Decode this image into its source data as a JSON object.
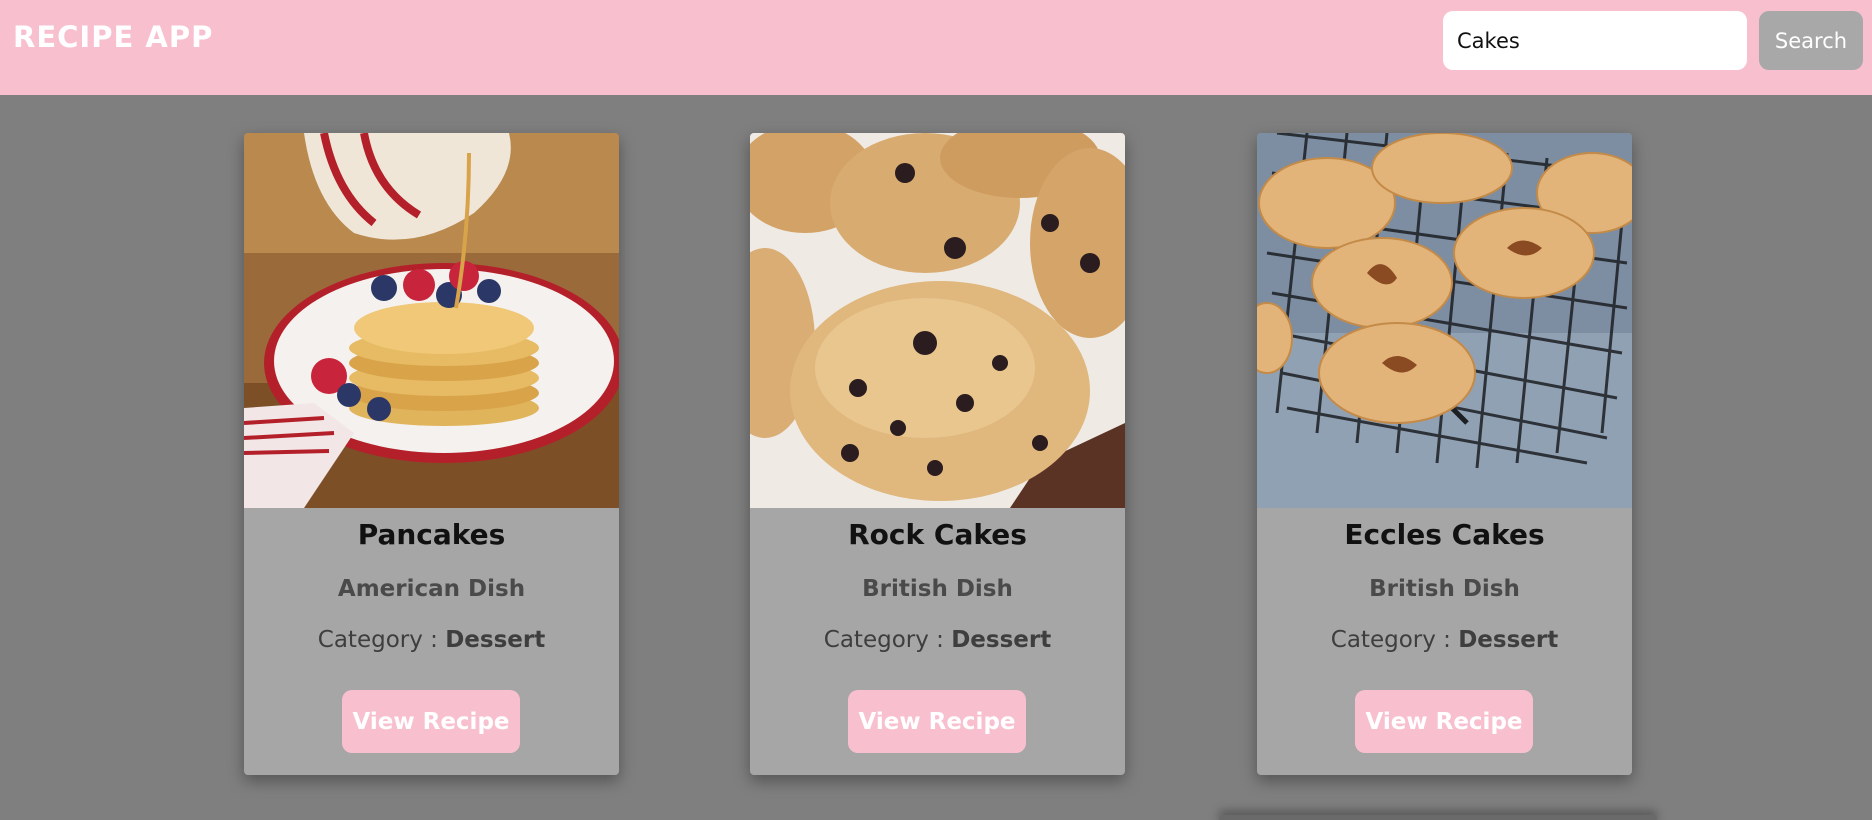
{
  "header": {
    "title": "RECIPE APP",
    "search_value": "Cakes",
    "search_button": "Search",
    "bg_color": "#f8c0cf"
  },
  "recipes": [
    {
      "name": "Pancakes",
      "area": "American Dish",
      "category_label": "Category : ",
      "category": "Dessert",
      "button": "View Recipe"
    },
    {
      "name": "Rock Cakes",
      "area": "British Dish",
      "category_label": "Category : ",
      "category": "Dessert",
      "button": "View Recipe"
    },
    {
      "name": "Eccles Cakes",
      "area": "British Dish",
      "category_label": "Category : ",
      "category": "Dessert",
      "button": "View Recipe"
    }
  ]
}
